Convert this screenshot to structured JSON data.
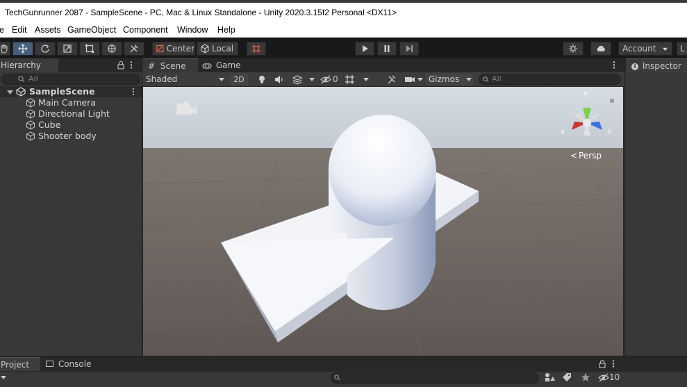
{
  "window": {
    "title": "TechGunrunner 2087 - SampleScene - PC, Mac & Linux Standalone - Unity 2020.3.15f2 Personal <DX11>"
  },
  "menu": {
    "items": [
      "e",
      "Edit",
      "Assets",
      "GameObject",
      "Component",
      "Window",
      "Help"
    ]
  },
  "toolbar": {
    "pivot_label": "Center",
    "space_label": "Local",
    "account_label": "Account",
    "layers_label": "L"
  },
  "hierarchy": {
    "tab_label": "Hierarchy",
    "search_placeholder": "All",
    "scene_name": "SampleScene",
    "items": [
      "Main Camera",
      "Directional Light",
      "Cube",
      "Shooter body"
    ]
  },
  "scene": {
    "tab_scene": "Scene",
    "tab_game": "Game",
    "shading_mode": "Shaded",
    "toggle_2d": "2D",
    "hidden_count": "0",
    "gizmos_label": "Gizmos",
    "search_placeholder": "All",
    "persp_label": "Persp",
    "axis_x": "x",
    "axis_y": "y",
    "axis_z": "z"
  },
  "inspector": {
    "tab_label": "Inspector"
  },
  "bottom": {
    "tab_project": "Project",
    "tab_console": "Console",
    "hidden_count": "10"
  },
  "colors": {
    "accent_active": "#46607c",
    "panel": "#383838",
    "tabbar": "#282828",
    "toolbar": "#191919"
  }
}
